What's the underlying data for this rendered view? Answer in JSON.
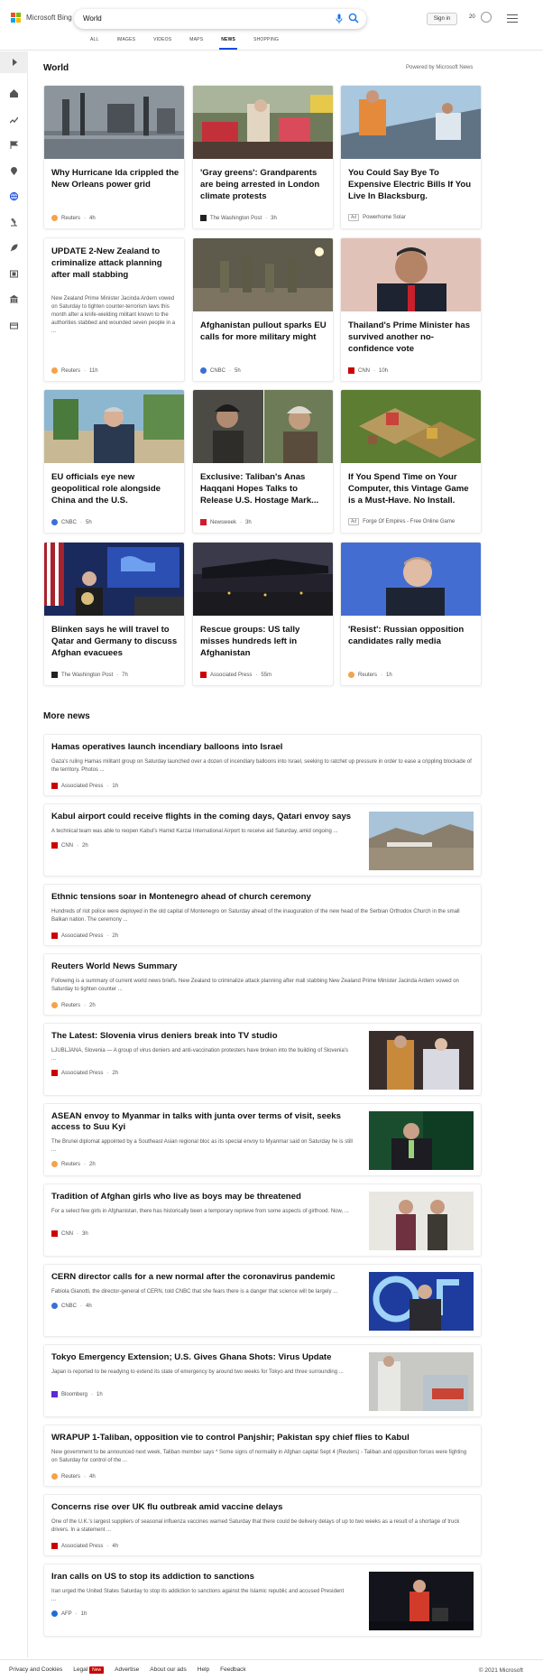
{
  "header": {
    "logo_text": "Microsoft Bing",
    "search_value": "World",
    "signin_label": "Sign in",
    "points": "20",
    "tabs": [
      {
        "label": "ALL"
      },
      {
        "label": "IMAGES"
      },
      {
        "label": "VIDEOS"
      },
      {
        "label": "MAPS"
      },
      {
        "label": "NEWS",
        "active": true
      },
      {
        "label": "SHOPPING"
      }
    ]
  },
  "rail": {
    "icons": [
      "chevron-right-icon",
      "home-icon",
      "trending-icon",
      "flag-icon",
      "location-pin-icon",
      "globe-icon",
      "microscope-icon",
      "rocket-icon",
      "film-icon",
      "building-icon",
      "wallet-icon"
    ]
  },
  "section": {
    "title": "World",
    "powered_by": "Powered by Microsoft News"
  },
  "cards": [
    {
      "title": "Why Hurricane Ida crippled the New Orleans power grid",
      "source": "Reuters",
      "time": "4h",
      "logo_color": "#f5a24b"
    },
    {
      "title": "'Gray greens': Grandparents are being arrested in London climate protests",
      "source": "The Washington Post",
      "time": "3h",
      "logo_color": "#222"
    },
    {
      "title": "You Could Say Bye To Expensive Electric Bills If You Live In Blacksburg.",
      "source": "Powerhome Solar",
      "ad": "Ad",
      "logo_color": ""
    },
    {
      "title": "UPDATE 2-New Zealand to criminalize attack planning after mall stabbing",
      "desc": "New Zealand Prime Minister Jacinda Ardern vowed on Saturday to tighten counter-terrorism laws this month after a knife-wielding militant known to the authorities stabbed and wounded seven people in a ...",
      "source": "Reuters",
      "time": "11h",
      "logo_color": "#f5a24b"
    },
    {
      "title": "Afghanistan pullout sparks EU calls for more military might",
      "source": "CNBC",
      "time": "5h",
      "logo_color": "#3b6fd6"
    },
    {
      "title": "Thailand's Prime Minister has survived another no-confidence vote",
      "source": "CNN",
      "time": "10h",
      "logo_color": "#cc0000"
    },
    {
      "title": "EU officials eye new geopolitical role alongside China and the U.S.",
      "source": "CNBC",
      "time": "5h",
      "logo_color": "#3b6fd6"
    },
    {
      "title": "Exclusive: Taliban's Anas Haqqani Hopes Talks to Release U.S. Hostage Mark...",
      "source": "Newsweek",
      "time": "3h",
      "logo_color": "#d01d2c"
    },
    {
      "title": "If You Spend Time on Your Computer, this Vintage Game is a Must-Have. No Install.",
      "source": "Forge Of Empires - Free Online Game",
      "ad": "Ad",
      "logo_color": ""
    },
    {
      "title": "Blinken says he will travel to Qatar and Germany to discuss Afghan evacuees",
      "source": "The Washington Post",
      "time": "7h",
      "logo_color": "#222"
    },
    {
      "title": "Rescue groups: US tally misses hundreds left in Afghanistan",
      "source": "Associated Press",
      "time": "55m",
      "logo_color": "#c00"
    },
    {
      "title": "'Resist': Russian opposition candidates rally media",
      "source": "Reuters",
      "time": "1h",
      "logo_color": "#f5a24b"
    }
  ],
  "more_news": {
    "title": "More news",
    "items": [
      {
        "title": "Hamas operatives launch incendiary balloons into Israel",
        "desc": "Gaza's ruling Hamas militant group on Saturday launched over a dozen of incendiary balloons into Israel, seeking to ratchet up pressure in order to ease a crippling blockade of the territory. Photos ...",
        "source": "Associated Press",
        "time": "1h",
        "logo_color": "#c00"
      },
      {
        "title": "Kabul airport could receive flights in the coming days, Qatari envoy says",
        "desc": "A technical team was able to reopen Kabul's Hamid Karzai International Airport to receive aid Saturday, amid ongoing ...",
        "source": "CNN",
        "time": "2h",
        "logo_color": "#cc0000"
      },
      {
        "title": "Ethnic tensions soar in Montenegro ahead of church ceremony",
        "desc": "Hundreds of riot police were deployed in the old capital of Montenegro on Saturday ahead of the inauguration of the new head of the Serbian Orthodox Church in the small Balkan nation. The ceremony ...",
        "source": "Associated Press",
        "time": "2h",
        "logo_color": "#c00"
      },
      {
        "title": "Reuters World News Summary",
        "desc": "Following is a summary of current world news briefs. New Zealand to criminalize attack planning after mall stabbing New Zealand Prime Minister Jacinda Ardern vowed on Saturday to tighten counter ...",
        "source": "Reuters",
        "time": "2h",
        "logo_color": "#f5a24b"
      },
      {
        "title": "The Latest: Slovenia virus deniers break into TV studio",
        "desc": "LJUBLJANA, Slovenia — A group of virus deniers and anti-vaccination protesters have broken into the building of Slovenia's ...",
        "source": "Associated Press",
        "time": "2h",
        "logo_color": "#c00"
      },
      {
        "title": "ASEAN envoy to Myanmar in talks with junta over terms of visit, seeks access to Suu Kyi",
        "desc": "The Brunei diplomat appointed by a Southeast Asian regional bloc as its special envoy to Myanmar said on Saturday he is still ...",
        "source": "Reuters",
        "time": "2h",
        "logo_color": "#f5a24b"
      },
      {
        "title": "Tradition of Afghan girls who live as boys may be threatened",
        "desc": "For a select few girls in Afghanistan, there has historically been a temporary reprieve from some aspects of girlhood. Now, ...",
        "source": "CNN",
        "time": "3h",
        "logo_color": "#cc0000"
      },
      {
        "title": "CERN director calls for a new normal after the coronavirus pandemic",
        "desc": "Fabiola Gianotti, the director-general of CERN, told CNBC that she fears there is a danger that science will be largely ...",
        "source": "CNBC",
        "time": "4h",
        "logo_color": "#3b6fd6"
      },
      {
        "title": "Tokyo Emergency Extension; U.S. Gives Ghana Shots: Virus Update",
        "desc": "Japan is reported to be readying to extend its state of emergency by around two weeks for Tokyo and three surrounding ...",
        "source": "Bloomberg",
        "time": "1h",
        "logo_color": "#5b2bd4"
      },
      {
        "title": "WRAPUP 1-Taliban, opposition vie to control Panjshir; Pakistan spy chief flies to Kabul",
        "desc": "New government to be announced next week, Taliban member says * Some signs of normality in Afghan capital Sept 4 (Reuters) - Taliban and opposition forces were fighting on Saturday for control of the ...",
        "source": "Reuters",
        "time": "4h",
        "logo_color": "#f5a24b"
      },
      {
        "title": "Concerns rise over UK flu outbreak amid vaccine delays",
        "desc": "One of the U.K.'s largest suppliers of seasonal influenza vaccines warned Saturday that there could be delivery delays of up to two weeks as a result of a shortage of truck drivers. In a statement ...",
        "source": "Associated Press",
        "time": "4h",
        "logo_color": "#c00"
      },
      {
        "title": "Iran calls on US to stop its addiction to sanctions",
        "desc": "Iran urged the United States Saturday to stop its addiction to sanctions against the Islamic republic and accused President ...",
        "source": "AFP",
        "time": "1h",
        "logo_color": "#1d6fd1"
      }
    ]
  },
  "footer": {
    "links": [
      "Privacy and Cookies",
      "Legal",
      "Advertise",
      "About our ads",
      "Help",
      "Feedback"
    ],
    "new_badge": "New",
    "copyright": "© 2021 Microsoft"
  },
  "colors": {
    "accent": "#174ae4",
    "ad_bg": "#fff"
  }
}
